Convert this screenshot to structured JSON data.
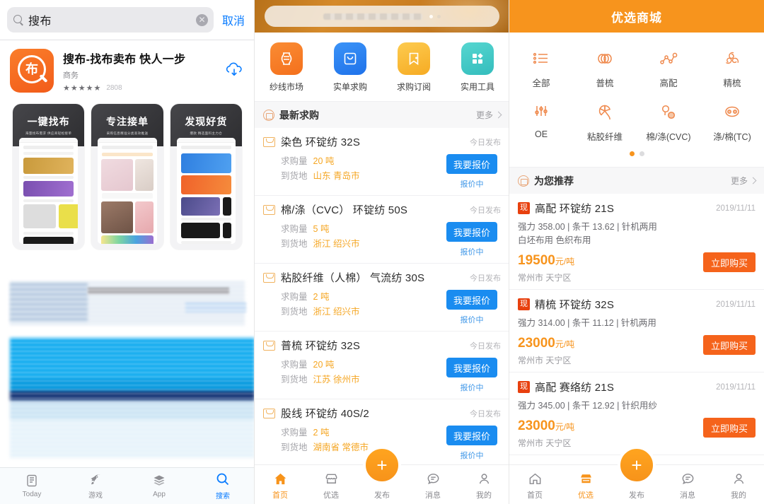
{
  "left_panel": {
    "search": {
      "query": "搜布",
      "cancel_label": "取消",
      "search_icon": "search-icon",
      "clear_icon": "clear-icon"
    },
    "app": {
      "name": "搜布-找布卖布 快人一步",
      "category": "商务",
      "stars": "★★★★★",
      "rating_count": "2808",
      "get_icon": "download-cloud-icon"
    },
    "screenshots": [
      {
        "title": "一键找布",
        "subtitle": "海量找布需求 供应商轻松接单"
      },
      {
        "title": "专注接单",
        "subtitle": "采购信息精准分类高效推送"
      },
      {
        "title": "发现好货",
        "subtitle": "爆款 精选面料主力仓"
      }
    ],
    "tabs": [
      {
        "label": "Today",
        "icon": "today-icon",
        "active": false
      },
      {
        "label": "游戏",
        "icon": "rocket-icon",
        "active": false
      },
      {
        "label": "App",
        "icon": "stack-icon",
        "active": false
      },
      {
        "label": "搜索",
        "icon": "search-icon",
        "active": true
      }
    ]
  },
  "middle_panel": {
    "banner": {
      "search_placeholder": "搜索你想要的纱线",
      "dots": [
        "on",
        "off"
      ]
    },
    "quick_actions": [
      {
        "label": "纱线市场",
        "icon": "yarn-spool-icon",
        "color": "#f7812a"
      },
      {
        "label": "实单求购",
        "icon": "bag-icon",
        "color": "#2b85f5"
      },
      {
        "label": "求购订阅",
        "icon": "bookmark-plus-icon",
        "color": "#fbbf38"
      },
      {
        "label": "实用工具",
        "icon": "grid-tools-icon",
        "color": "#45c8c8"
      }
    ],
    "section": {
      "title": "最新求购",
      "more_label": "更多",
      "icon": "inbox-circle-icon"
    },
    "requests": [
      {
        "title": "染色 环锭纺 32S",
        "time": "今日发布",
        "qty_label": "求购量",
        "qty": "20 吨",
        "dest_label": "到货地",
        "dest": "山东 青岛市",
        "button": "我要报价",
        "status": "报价中"
      },
      {
        "title": "棉/涤（CVC） 环锭纺 50S",
        "time": "今日发布",
        "qty_label": "求购量",
        "qty": "5 吨",
        "dest_label": "到货地",
        "dest": "浙江 绍兴市",
        "button": "我要报价",
        "status": "报价中"
      },
      {
        "title": "粘胶纤维（人棉） 气流纺 30S",
        "time": "今日发布",
        "qty_label": "求购量",
        "qty": "2 吨",
        "dest_label": "到货地",
        "dest": "浙江 绍兴市",
        "button": "我要报价",
        "status": "报价中"
      },
      {
        "title": "普梳 环锭纺 32S",
        "time": "今日发布",
        "qty_label": "求购量",
        "qty": "20 吨",
        "dest_label": "到货地",
        "dest": "江苏 徐州市",
        "button": "我要报价",
        "status": "报价中"
      },
      {
        "title": "股线 环锭纺 40S/2",
        "time": "今日发布",
        "qty_label": "求购量",
        "qty": "2 吨",
        "dest_label": "到货地",
        "dest": "湖南省 常德市",
        "button": "我要报价",
        "status": "报价中"
      }
    ],
    "fab": {
      "label": "+",
      "icon": "plus-icon"
    },
    "tabs": [
      {
        "label": "首页",
        "icon": "home-icon",
        "active": true
      },
      {
        "label": "优选",
        "icon": "shop-icon",
        "active": false
      },
      {
        "label": "发布",
        "icon": "publish-icon",
        "active": false
      },
      {
        "label": "消息",
        "icon": "message-icon",
        "active": false
      },
      {
        "label": "我的",
        "icon": "user-icon",
        "active": false
      }
    ]
  },
  "right_panel": {
    "header": {
      "title": "优选商城"
    },
    "categories": [
      {
        "label": "全部",
        "icon": "list-icon"
      },
      {
        "label": "普梳",
        "icon": "rings-icon"
      },
      {
        "label": "高配",
        "icon": "nodes-icon"
      },
      {
        "label": "精梳",
        "icon": "spiral-icon"
      },
      {
        "label": "OE",
        "icon": "sliders-icon"
      },
      {
        "label": "粘胶纤维",
        "icon": "fan-icon"
      },
      {
        "label": "棉/涤(CVC)",
        "icon": "two-circles-icon"
      },
      {
        "label": "涤/棉(TC)",
        "icon": "crab-icon"
      }
    ],
    "pager": [
      "on",
      "off"
    ],
    "section": {
      "title": "为您推荐",
      "more_label": "更多",
      "icon": "smile-circle-icon"
    },
    "products": [
      {
        "badge": "现",
        "name": "高配 环锭纺 21S",
        "date": "2019/11/11",
        "spec": "强力 358.00 | 条干 13.62 | 针机两用",
        "spec2": "白坯布用 色织布用",
        "price": "19500",
        "unit": "元/吨",
        "location": "常州市 天宁区",
        "button": "立即购买"
      },
      {
        "badge": "现",
        "name": "精梳 环锭纺 32S",
        "date": "2019/11/11",
        "spec": "强力 314.00 | 条干 11.12 | 针机两用",
        "spec2": "",
        "price": "23000",
        "unit": "元/吨",
        "location": "常州市 天宁区",
        "button": "立即购买"
      },
      {
        "badge": "现",
        "name": "高配 赛络纺 21S",
        "date": "2019/11/11",
        "spec": "强力 345.00 | 条干 12.92 | 针织用纱",
        "spec2": "",
        "price": "23000",
        "unit": "元/吨",
        "location": "常州市 天宁区",
        "button": "立即购买"
      }
    ],
    "fab": {
      "label": "+",
      "icon": "plus-icon"
    },
    "tabs": [
      {
        "label": "首页",
        "icon": "home-icon",
        "active": false
      },
      {
        "label": "优选",
        "icon": "shop-icon",
        "active": true
      },
      {
        "label": "发布",
        "icon": "publish-icon",
        "active": false
      },
      {
        "label": "消息",
        "icon": "message-icon",
        "active": false
      },
      {
        "label": "我的",
        "icon": "user-icon",
        "active": false
      }
    ]
  },
  "colors": {
    "brand_orange": "#f7941d",
    "buy_orange": "#f5631b",
    "quote_blue": "#1a8cf0",
    "ios_blue": "#0a7cff",
    "value_amber": "#f5a623"
  }
}
